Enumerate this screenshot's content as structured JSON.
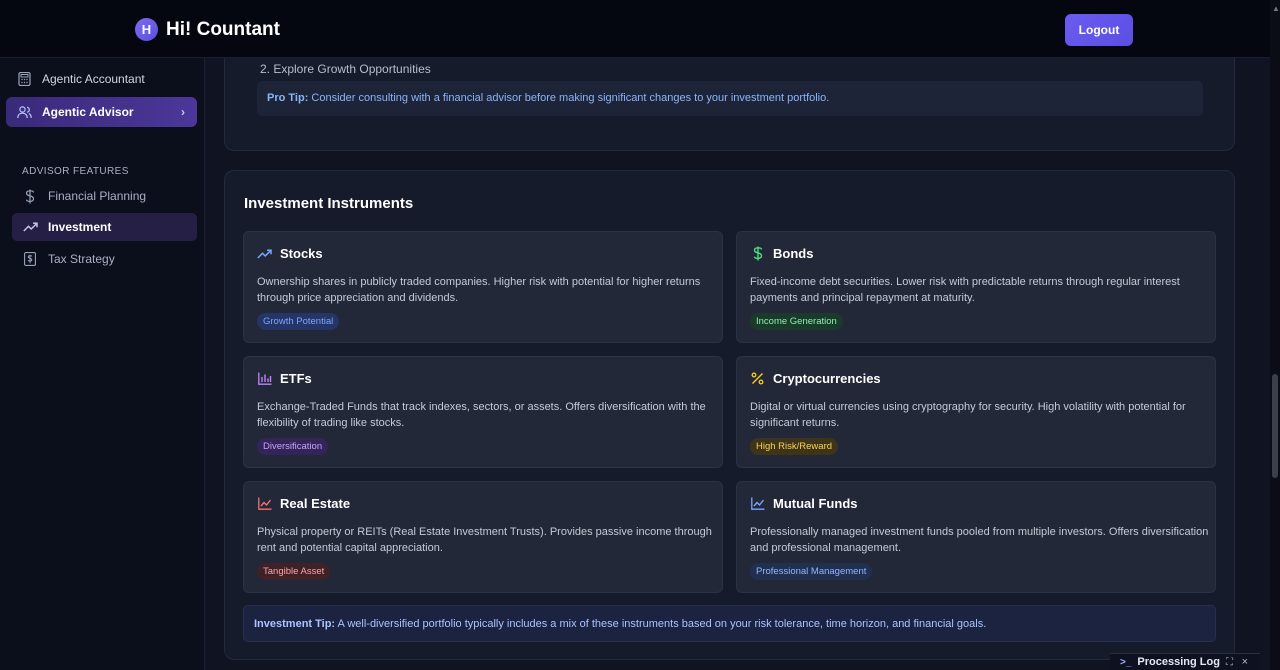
{
  "app": {
    "title": "Hi! Countant",
    "logo_glyph": "H"
  },
  "header": {
    "logout_label": "Logout"
  },
  "sidebar": {
    "items": [
      {
        "label": "Agentic Accountant",
        "icon": "calculator-icon"
      },
      {
        "label": "Agentic Advisor",
        "icon": "users-icon",
        "chevron": "›"
      }
    ],
    "section_title": "ADVISOR FEATURES",
    "features": [
      {
        "label": "Financial Planning",
        "icon": "dollar-icon"
      },
      {
        "label": "Investment",
        "icon": "trending-up-icon"
      },
      {
        "label": "Tax Strategy",
        "icon": "receipt-icon"
      }
    ]
  },
  "top_card": {
    "step": "2. Explore Growth Opportunities",
    "protip_label": "Pro Tip:",
    "protip_text": " Consider consulting with a financial advisor before making significant changes to your investment portfolio."
  },
  "investment": {
    "title": "Investment Instruments",
    "instruments": [
      {
        "name": "Stocks",
        "icon": "trending-up-icon",
        "icon_color": "#7aa6ff",
        "desc": "Ownership shares in publicly traded companies. Higher risk with potential for higher returns through price appreciation and dividends.",
        "tag": "Growth Potential",
        "tag_color": "#7aa6ff",
        "tag_bg": "#253666"
      },
      {
        "name": "Bonds",
        "icon": "dollar-icon",
        "icon_color": "#4ade80",
        "desc": "Fixed-income debt securities. Lower risk with predictable returns through regular interest payments and principal repayment at maturity.",
        "tag": "Income Generation",
        "tag_color": "#86efac",
        "tag_bg": "#1c3a2c"
      },
      {
        "name": "ETFs",
        "icon": "bar-chart-icon",
        "icon_color": "#c084fc",
        "desc": "Exchange-Traded Funds that track indexes, sectors, or assets. Offers diversification with the flexibility of trading like stocks.",
        "tag": "Diversification",
        "tag_color": "#c4a5fb",
        "tag_bg": "#33255a"
      },
      {
        "name": "Cryptocurrencies",
        "icon": "percent-icon",
        "icon_color": "#facc15",
        "desc": "Digital or virtual currencies using cryptography for security. High volatility with potential for significant returns.",
        "tag": "High Risk/Reward",
        "tag_color": "#fcd34d",
        "tag_bg": "#3d341a"
      },
      {
        "name": "Real Estate",
        "icon": "line-chart-icon",
        "icon_color": "#f87171",
        "desc": "Physical property or REITs (Real Estate Investment Trusts). Provides passive income through rent and potential capital appreciation.",
        "tag": "Tangible Asset",
        "tag_color": "#fca5a5",
        "tag_bg": "#3f2128"
      },
      {
        "name": "Mutual Funds",
        "icon": "line-chart-icon",
        "icon_color": "#7aa6ff",
        "desc": "Professionally managed investment funds pooled from multiple investors. Offers diversification and professional management.",
        "tag": "Professional Management",
        "tag_color": "#93b4ff",
        "tag_bg": "#22304f"
      }
    ],
    "tip_label": "Investment Tip:",
    "tip_text": " A well-diversified portfolio typically includes a mix of these instruments based on your risk tolerance, time horizon, and financial goals."
  },
  "processing_log": {
    "label": "Processing Log",
    "icon": "terminal-icon",
    "expand_icon": "⛶",
    "close_icon": "×"
  }
}
